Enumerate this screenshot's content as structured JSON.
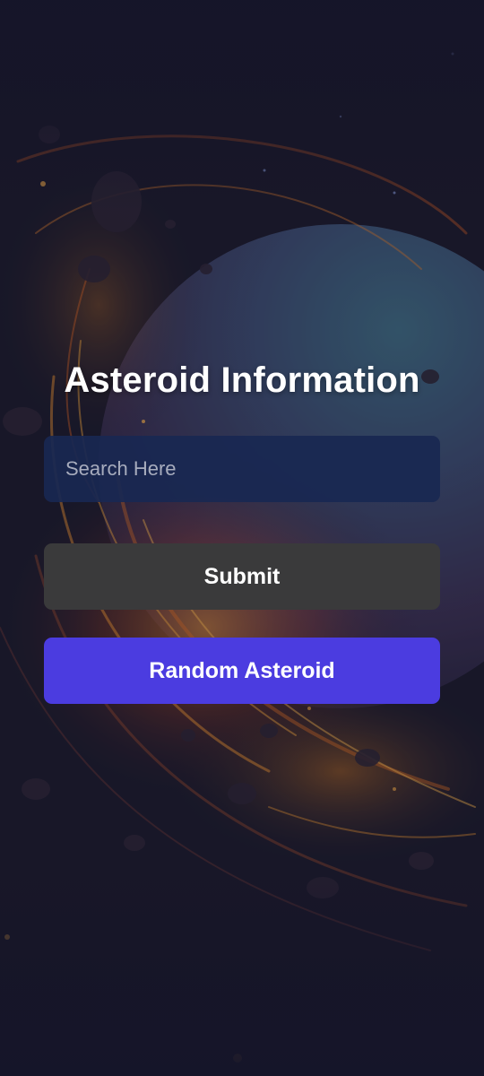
{
  "app": {
    "title": "Asteroid Information"
  },
  "search": {
    "placeholder": "Search Here",
    "value": ""
  },
  "buttons": {
    "submit_label": "Submit",
    "random_label": "Random Asteroid"
  },
  "colors": {
    "background": "#181729",
    "search_field": "#192852",
    "submit_button": "#3a3a3b",
    "random_button": "#4b3ce0",
    "text": "#ffffff",
    "placeholder": "#a7acbd"
  }
}
